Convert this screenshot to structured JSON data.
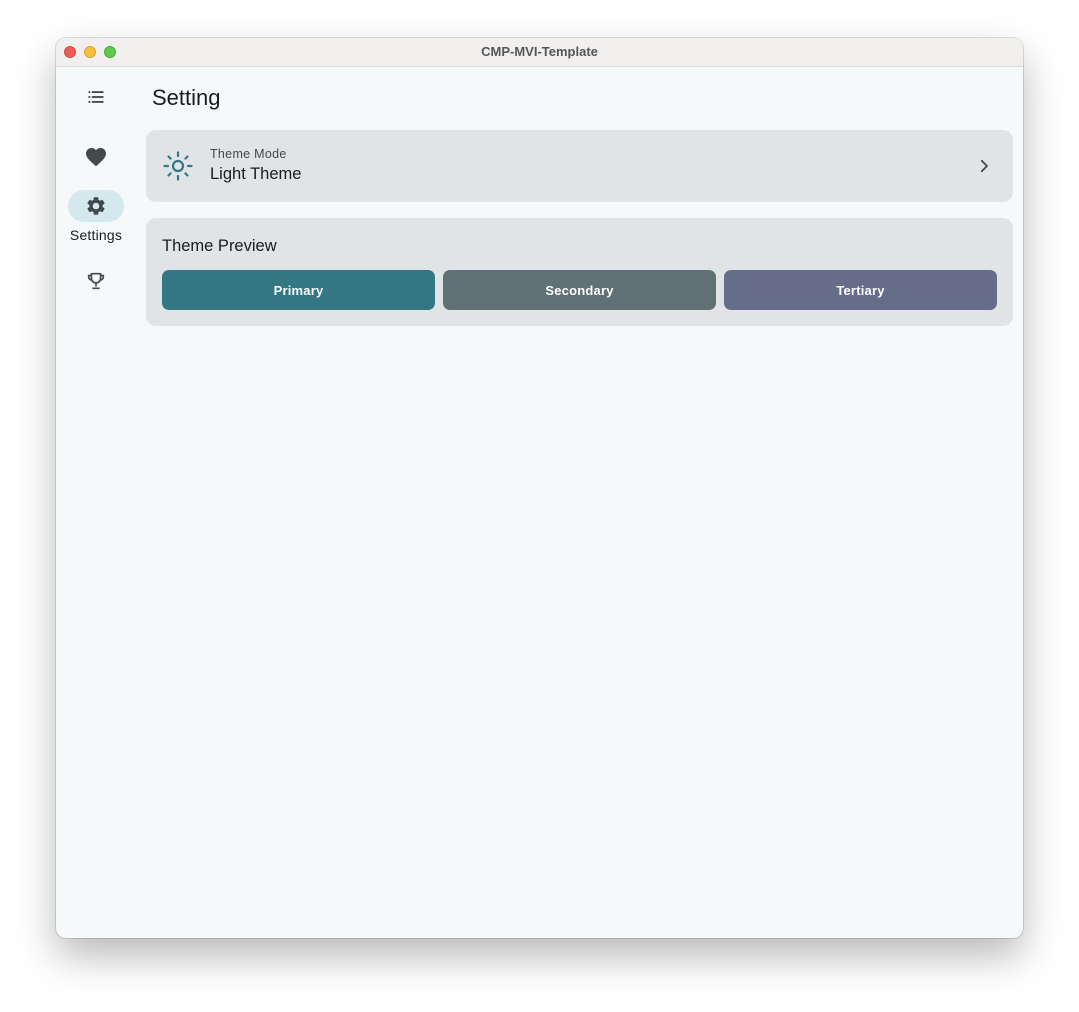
{
  "window": {
    "title": "CMP-MVI-Template"
  },
  "rail": {
    "items": [
      {
        "icon": "list-icon",
        "label": "",
        "active": false
      },
      {
        "icon": "heart-icon",
        "label": "",
        "active": false
      },
      {
        "icon": "gear-icon",
        "label": "Settings",
        "active": true
      },
      {
        "icon": "trophy-icon",
        "label": "",
        "active": false
      }
    ]
  },
  "page": {
    "title": "Setting"
  },
  "theme_mode": {
    "caption": "Theme Mode",
    "value": "Light Theme",
    "icon": "sun-icon",
    "chevron": "chevron-right-icon"
  },
  "preview": {
    "title": "Theme Preview",
    "buttons": [
      {
        "label": "Primary",
        "color": "#337784"
      },
      {
        "label": "Secondary",
        "color": "#5f7174"
      },
      {
        "label": "Tertiary",
        "color": "#666d89"
      }
    ]
  },
  "colors": {
    "background": "#f5f9fa",
    "card": "#e0e4e6",
    "accent": "#337784",
    "rail_active": "#d4e8ee"
  }
}
